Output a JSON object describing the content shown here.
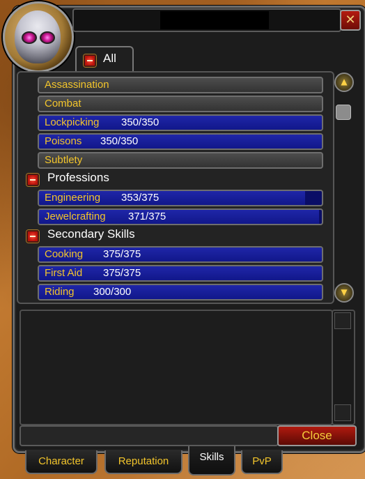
{
  "window": {
    "close_glyph": "✕"
  },
  "filter_tab": {
    "label": "All"
  },
  "skills": [
    {
      "kind": "category",
      "name": "Assassination"
    },
    {
      "kind": "category",
      "name": "Combat"
    },
    {
      "kind": "skill",
      "name": "Lockpicking",
      "value": "350/350",
      "fill": 1.0
    },
    {
      "kind": "skill",
      "name": "Poisons",
      "value": "350/350",
      "fill": 1.0
    },
    {
      "kind": "category",
      "name": "Subtlety"
    },
    {
      "kind": "header",
      "name": "Professions"
    },
    {
      "kind": "skill",
      "name": "Engineering",
      "value": "353/375",
      "fill": 0.941
    },
    {
      "kind": "skill",
      "name": "Jewelcrafting",
      "value": "371/375",
      "fill": 0.989
    },
    {
      "kind": "header",
      "name": "Secondary Skills"
    },
    {
      "kind": "skill",
      "name": "Cooking",
      "value": "375/375",
      "fill": 1.0
    },
    {
      "kind": "skill",
      "name": "First Aid",
      "value": "375/375",
      "fill": 1.0
    },
    {
      "kind": "skill",
      "name": "Riding",
      "value": "300/300",
      "fill": 1.0
    }
  ],
  "close_button": {
    "label": "Close"
  },
  "tabs": [
    {
      "label": "Character",
      "active": false
    },
    {
      "label": "Reputation",
      "active": false
    },
    {
      "label": "Skills",
      "active": true
    },
    {
      "label": "PvP",
      "active": false
    }
  ],
  "icons": {
    "scroll_up": "scroll-up-icon",
    "scroll_down": "scroll-down-icon",
    "collapse": "collapse-minus-icon"
  }
}
